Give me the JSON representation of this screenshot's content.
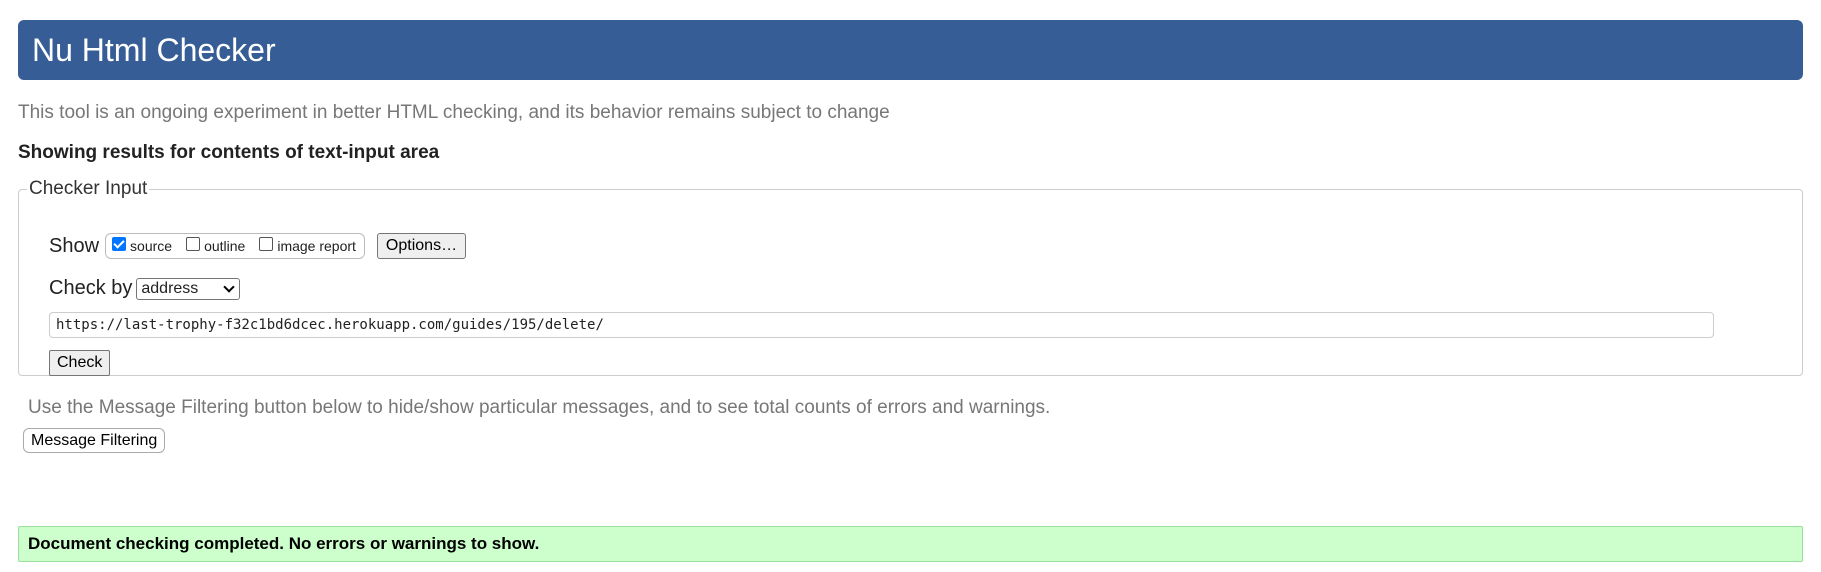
{
  "header": {
    "title": "Nu Html Checker"
  },
  "intro_text": "This tool is an ongoing experiment in better HTML checking, and its behavior remains subject to change",
  "results_heading": "Showing results for contents of text-input area",
  "checker_input": {
    "legend": "Checker Input",
    "show_label": "Show",
    "show_options": [
      {
        "label": "source",
        "checked": true
      },
      {
        "label": "outline",
        "checked": false
      },
      {
        "label": "image report",
        "checked": false
      }
    ],
    "options_button": "Options…",
    "check_by_label": "Check by",
    "check_by_value": "address",
    "url_value": "https://last-trophy-f32c1bd6dcec.herokuapp.com/guides/195/delete/",
    "check_button": "Check"
  },
  "filter": {
    "hint": "Use the Message Filtering button below to hide/show particular messages, and to see total counts of errors and warnings.",
    "button": "Message Filtering"
  },
  "result_message": "Document checking completed. No errors or warnings to show.",
  "colors": {
    "title_bar": "#365d95",
    "success_bg": "#ccffcc",
    "checkbox_checked": "#0075ff"
  }
}
